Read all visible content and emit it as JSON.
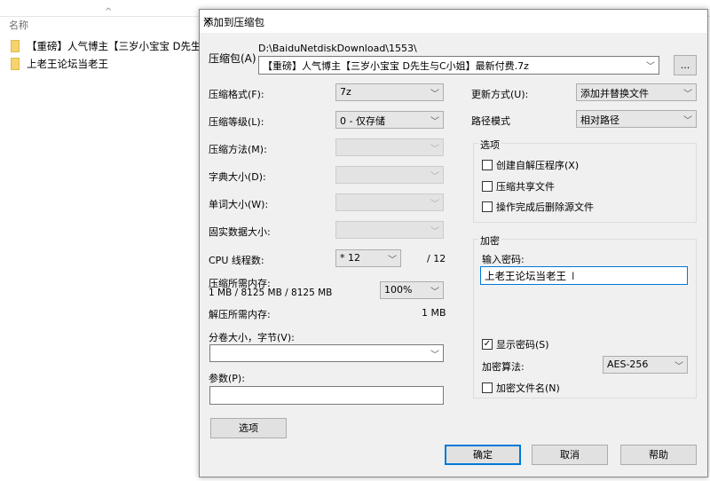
{
  "explorer": {
    "column_name": "名称",
    "files": [
      "【重磅】人气博主【三岁小宝宝 D先生与",
      "上老王论坛当老王"
    ]
  },
  "dialog": {
    "title": "添加到压缩包",
    "archive_label": "压缩包(A)",
    "archive_path": "D:\\BaiduNetdiskDownload\\1553\\",
    "archive_name": "【重磅】人气博主【三岁小宝宝 D先生与C小姐】最新付费.7z",
    "browse": "...",
    "format_label": "压缩格式(F):",
    "format": "7z",
    "level_label": "压缩等级(L):",
    "level": "0 - 仅存储",
    "method_label": "压缩方法(M):",
    "dict_label": "字典大小(D):",
    "word_label": "单词大小(W):",
    "solid_label": "固实数据大小:",
    "cpu_label": "CPU 线程数:",
    "cpu": "* 12",
    "cpu_total": "/ 12",
    "mem_label": "压缩所需内存:",
    "mem_value": "1 MB / 8125 MB / 8125 MB",
    "mem_pct": "100%",
    "dmem_label": "解压所需内存:",
    "dmem_value": "1 MB",
    "volume_label": "分卷大小，字节(V):",
    "params_label": "参数(P):",
    "options_btn": "选项",
    "update_label": "更新方式(U):",
    "update": "添加并替换文件",
    "path_label": "路径模式",
    "path": "相对路径",
    "options_group": "选项",
    "opt_sfx": "创建自解压程序(X)",
    "opt_shared": "压缩共享文件",
    "opt_delete": "操作完成后删除源文件",
    "enc_group": "加密",
    "pwd_label": "输入密码:",
    "pwd": "上老王论坛当老王",
    "show_pwd": "显示密码(S)",
    "algo_label": "加密算法:",
    "algo": "AES-256",
    "enc_names": "加密文件名(N)",
    "ok": "确定",
    "cancel": "取消",
    "help": "帮助",
    "close": "✕"
  }
}
